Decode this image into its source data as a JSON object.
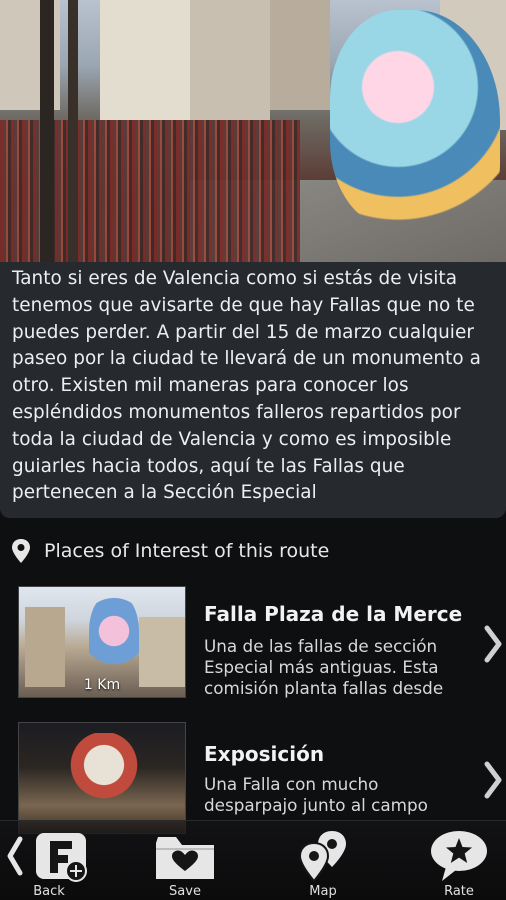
{
  "description": "Tanto si eres de Valencia como si estás de visita tenemos que avisarte de que hay Fallas que no te puedes perder.  A partir del 15 de marzo cualquier paseo por la ciudad te llevará de un monumento a otro. Existen mil maneras para conocer los espléndidos monumentos falleros repartidos por toda la ciudad de Valencia y como es imposible guiarles hacia todos, aquí te las Fallas que pertenecen a la Sección Especial",
  "section": {
    "title": "Places of Interest of this route",
    "icon": "map-pin-icon"
  },
  "places": [
    {
      "title": "Falla Plaza de la Merce",
      "summary": "Una de las fallas de sección Especial más antiguas. Esta comisión planta fallas desde",
      "distance": "1 Km"
    },
    {
      "title": "Exposición",
      "summary": "Una Falla con mucho desparpajo junto al campo",
      "distance": ""
    }
  ],
  "toolbar": {
    "back": "Back",
    "save": "Save",
    "map": "Map",
    "rate": "Rate"
  },
  "colors": {
    "panel": "#2a2e34",
    "background": "#0e0f11",
    "text": "#eceff2"
  }
}
